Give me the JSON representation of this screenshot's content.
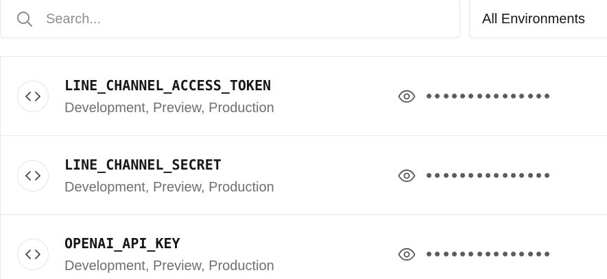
{
  "search": {
    "placeholder": "Search...",
    "value": ""
  },
  "filter": {
    "selected": "All Environments"
  },
  "variables": [
    {
      "name": "LINE_CHANNEL_ACCESS_TOKEN",
      "environments": "Development, Preview, Production",
      "masked_length": 15
    },
    {
      "name": "LINE_CHANNEL_SECRET",
      "environments": "Development, Preview, Production",
      "masked_length": 15
    },
    {
      "name": "OPENAI_API_KEY",
      "environments": "Development, Preview, Production",
      "masked_length": 15
    }
  ],
  "icons": {
    "search": "search-icon",
    "code": "code-icon",
    "reveal": "eye-icon"
  },
  "colors": {
    "border": "#e5e5e5",
    "text_primary": "#171717",
    "text_secondary": "#6f6f6f",
    "placeholder": "#8f8f8f",
    "mask_dot": "#5c5c5c"
  }
}
